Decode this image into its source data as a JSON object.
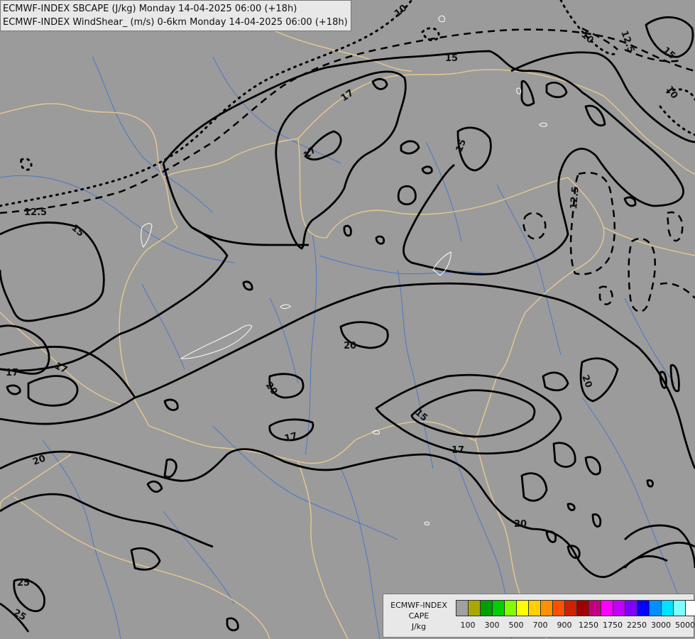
{
  "titles": {
    "line1": "ECMWF-INDEX SBCAPE (J/kg) Monday 14-04-2025 06:00 (+18h)",
    "line2": "ECMWF-INDEX WindShear_ (m/s) 0-6km Monday 14-04-2025 06:00 (+18h)"
  },
  "legend": {
    "line1": "ECMWF-INDEX",
    "line2": "CAPE",
    "line3": "J/kg",
    "colors": [
      "#a0a0a0",
      "#a8a800",
      "#00a000",
      "#00d000",
      "#80ff00",
      "#ffff00",
      "#ffd000",
      "#ff9000",
      "#ff5000",
      "#d02000",
      "#a00000",
      "#c00080",
      "#ff00ff",
      "#c000ff",
      "#8000ff",
      "#0000ff",
      "#0090ff",
      "#00e0ff",
      "#80ffff",
      "#ffffff"
    ],
    "ticks": [
      "100",
      "300",
      "500",
      "700",
      "900",
      "1250",
      "1750",
      "2250",
      "3000",
      "5000"
    ]
  },
  "contour_labels": {
    "l10a": "10",
    "l10b": "10",
    "l10c": "10",
    "l125a": "12.5",
    "l125b": "12.5",
    "l125c": "12.5",
    "l15a": "15",
    "l15b": "15",
    "l15c": "15",
    "l15d": "15",
    "l15e": "15",
    "l17a": "17",
    "l17b": "17",
    "l17c": "17",
    "l17d": "17",
    "l17e": "17",
    "l17f": "17",
    "l20a": "20",
    "l20b": "20",
    "l20c": "20",
    "l20d": "20",
    "l20e": "20",
    "l25a": "25",
    "l25b": "25"
  },
  "colors": {
    "background": "#9b9b9b",
    "borders": "#e8c890",
    "rivers": "#4a78c8",
    "contours": "#000000"
  }
}
